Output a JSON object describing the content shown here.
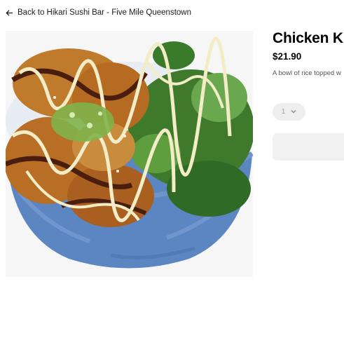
{
  "nav": {
    "back_label": "Back to Hikari Sushi Bar - Five Mile Queenstown",
    "back_icon": "arrow-left-icon"
  },
  "item": {
    "title": "Chicken K",
    "price": "$21.90",
    "description": "A bowl of rice topped w",
    "image_alt": "Chicken katsu rice bowl with salad in a blue bowl"
  },
  "order": {
    "quantity": "1",
    "quantity_icon": "chevron-down-icon"
  },
  "colors": {
    "bowl_blue": "#5b86c2",
    "text_primary": "#000000",
    "text_secondary": "#545454",
    "control_bg": "#eeeeee"
  }
}
